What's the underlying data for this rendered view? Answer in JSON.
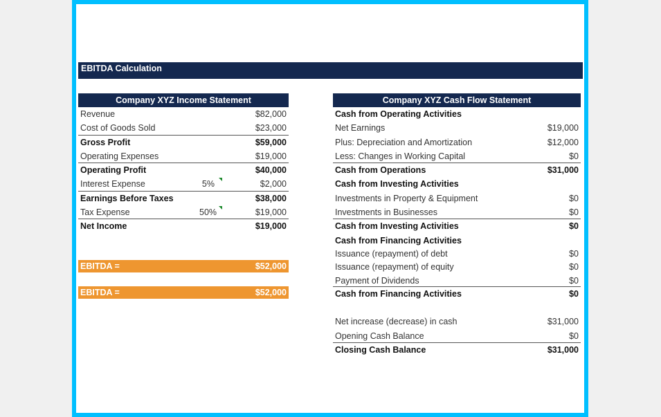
{
  "title": "EBITDA Calculation",
  "income_statement": {
    "header": "Company XYZ Income Statement",
    "rows": [
      {
        "label": "Revenue",
        "pct": "",
        "value": "$82,000",
        "bold": false,
        "rule": false
      },
      {
        "label": "Cost of Goods Sold",
        "pct": "",
        "value": "$23,000",
        "bold": false,
        "rule": true
      },
      {
        "label": "Gross Profit",
        "pct": "",
        "value": "$59,000",
        "bold": true,
        "rule": false
      },
      {
        "label": "Operating Expenses",
        "pct": "",
        "value": "$19,000",
        "bold": false,
        "rule": true
      },
      {
        "label": "Operating Profit",
        "pct": "",
        "value": "$40,000",
        "bold": true,
        "rule": false
      },
      {
        "label": "Interest Expense",
        "pct": "5%",
        "value": "$2,000",
        "bold": false,
        "rule": true
      },
      {
        "label": "Earnings Before Taxes",
        "pct": "",
        "value": "$38,000",
        "bold": true,
        "rule": false
      },
      {
        "label": "Tax Expense",
        "pct": "50%",
        "value": "$19,000",
        "bold": false,
        "rule": true
      },
      {
        "label": "Net Income",
        "pct": "",
        "value": "$19,000",
        "bold": true,
        "rule": false
      }
    ]
  },
  "ebitda_boxes": [
    {
      "label": "EBITDA =",
      "value": "$52,000"
    },
    {
      "label": "EBITDA =",
      "value": "$52,000"
    }
  ],
  "cash_flow_statement": {
    "header": "Company XYZ Cash Flow Statement",
    "rows": [
      {
        "label": "Cash from Operating Activities",
        "value": "",
        "bold": true,
        "rule": false
      },
      {
        "label": "Net Earnings",
        "value": "$19,000",
        "bold": false,
        "rule": false
      },
      {
        "label": "Plus: Depreciation and Amortization",
        "value": "$12,000",
        "bold": false,
        "rule": false
      },
      {
        "label": "Less: Changes in Working Capital",
        "value": "$0",
        "bold": false,
        "rule": true
      },
      {
        "label": "Cash from Operations",
        "value": "$31,000",
        "bold": true,
        "rule": false
      },
      {
        "label": "Cash from Investing Activities",
        "value": "",
        "bold": true,
        "rule": false
      },
      {
        "label": "Investments in Property & Equipment",
        "value": "$0",
        "bold": false,
        "rule": false
      },
      {
        "label": "Investments in Businesses",
        "value": "$0",
        "bold": false,
        "rule": true
      },
      {
        "label": "Cash from Investing Activities",
        "value": "$0",
        "bold": true,
        "rule": false
      },
      {
        "label": "Cash from Financing Activities",
        "value": "",
        "bold": true,
        "rule": false,
        "tight": true
      },
      {
        "label": "Issuance (repayment) of debt",
        "value": "$0",
        "bold": false,
        "rule": false,
        "tight": true
      },
      {
        "label": "Issuance (repayment) of equity",
        "value": "$0",
        "bold": false,
        "rule": false,
        "tight": true
      },
      {
        "label": "Payment of Dividends",
        "value": "$0",
        "bold": false,
        "rule": true,
        "tight": true
      },
      {
        "label": "Cash from Financing Activities",
        "value": "$0",
        "bold": true,
        "rule": false
      },
      {
        "gap": true
      },
      {
        "label": "Net increase (decrease) in cash",
        "value": "$31,000",
        "bold": false,
        "rule": false
      },
      {
        "label": "Opening Cash Balance",
        "value": "$0",
        "bold": false,
        "rule": true
      },
      {
        "label": "Closing Cash Balance",
        "value": "$31,000",
        "bold": true,
        "rule": false
      }
    ]
  }
}
